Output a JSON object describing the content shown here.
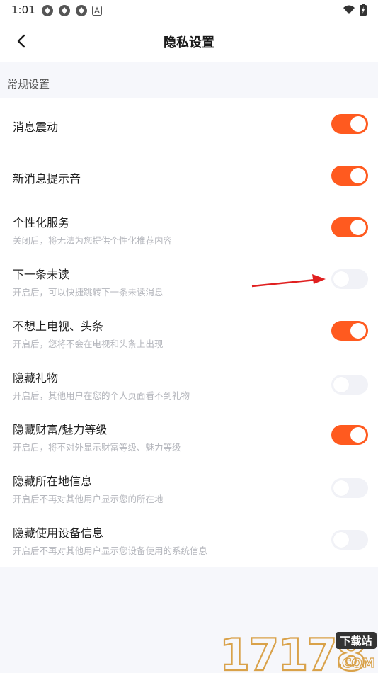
{
  "status_bar": {
    "time": "1:01"
  },
  "header": {
    "title": "隐私设置"
  },
  "section": {
    "label": "常规设置"
  },
  "settings": [
    {
      "title": "消息震动",
      "subtitle": "",
      "on": true
    },
    {
      "title": "新消息提示音",
      "subtitle": "",
      "on": true
    },
    {
      "title": "个性化服务",
      "subtitle": "关闭后，将无法为您提供个性化推荐内容",
      "on": true
    },
    {
      "title": "下一条未读",
      "subtitle": "开启后，可以快捷跳转下一条未读消息",
      "on": false
    },
    {
      "title": "不想上电视、头条",
      "subtitle": "开启后，您将不会在电视和头条上出现",
      "on": true
    },
    {
      "title": "隐藏礼物",
      "subtitle": "开启后，其他用户在您的个人页面看不到礼物",
      "on": false
    },
    {
      "title": "隐藏财富/魅力等级",
      "subtitle": "开启后，将不对外显示财富等级、魅力等级",
      "on": true
    },
    {
      "title": "隐藏所在地信息",
      "subtitle": "开启后不再对其他用户显示您的所在地",
      "on": false
    },
    {
      "title": "隐藏使用设备信息",
      "subtitle": "开启后不再对其他用户显示您设备使用的系统信息",
      "on": false
    }
  ],
  "colors": {
    "accent": "#FF5A1F",
    "toggle_off": "#F1F2F7",
    "annotation_arrow": "#E02020"
  },
  "watermark": {
    "digits": "17178",
    "badge": "下载站",
    "domain": ".COM"
  }
}
